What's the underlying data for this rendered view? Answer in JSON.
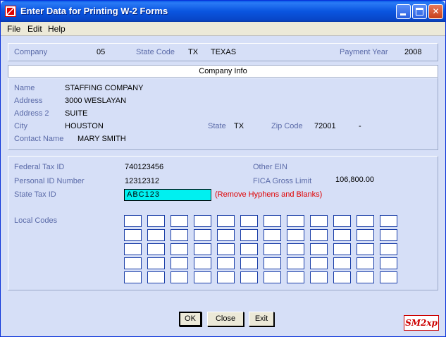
{
  "window": {
    "title": "Enter Data for Printing W-2 Forms"
  },
  "menu": {
    "file": "File",
    "edit": "Edit",
    "help": "Help"
  },
  "header": {
    "company_label": "Company",
    "company_value": "05",
    "state_code_label": "State Code",
    "state_code_value": "TX",
    "state_name_value": "TEXAS",
    "payment_year_label": "Payment Year",
    "payment_year_value": "2008"
  },
  "company_info": {
    "section_title": "Company Info",
    "name_label": "Name",
    "name_value": "STAFFING COMPANY",
    "address_label": "Address",
    "address_value": "3000 WESLAYAN",
    "address2_label": "Address 2",
    "address2_value": "SUITE",
    "city_label": "City",
    "city_value": "HOUSTON",
    "state_label": "State",
    "state_value": "TX",
    "zip_label": "Zip Code",
    "zip_value": "72001",
    "zip_ext": "-",
    "contact_label": "Contact Name",
    "contact_value": "MARY SMITH"
  },
  "tax_info": {
    "federal_tax_id_label": "Federal Tax ID",
    "federal_tax_id_value": "740123456",
    "other_ein_label": "Other EIN",
    "personal_id_label": "Personal ID Number",
    "personal_id_value": "12312312",
    "fica_label": "FICA Gross Limit",
    "fica_value": "106,800.00",
    "state_tax_id_label": "State Tax ID",
    "state_tax_id_value": "ABC123",
    "state_tax_note": "(Remove Hyphens and Blanks)",
    "local_codes_label": "Local Codes"
  },
  "buttons": {
    "ok": "OK",
    "close": "Close",
    "exit": "Exit"
  },
  "logo_text": "SM2xp",
  "icons": {
    "app": "app-icon",
    "minimize": "minimize-icon",
    "maximize": "maximize-icon",
    "close": "close-icon"
  }
}
